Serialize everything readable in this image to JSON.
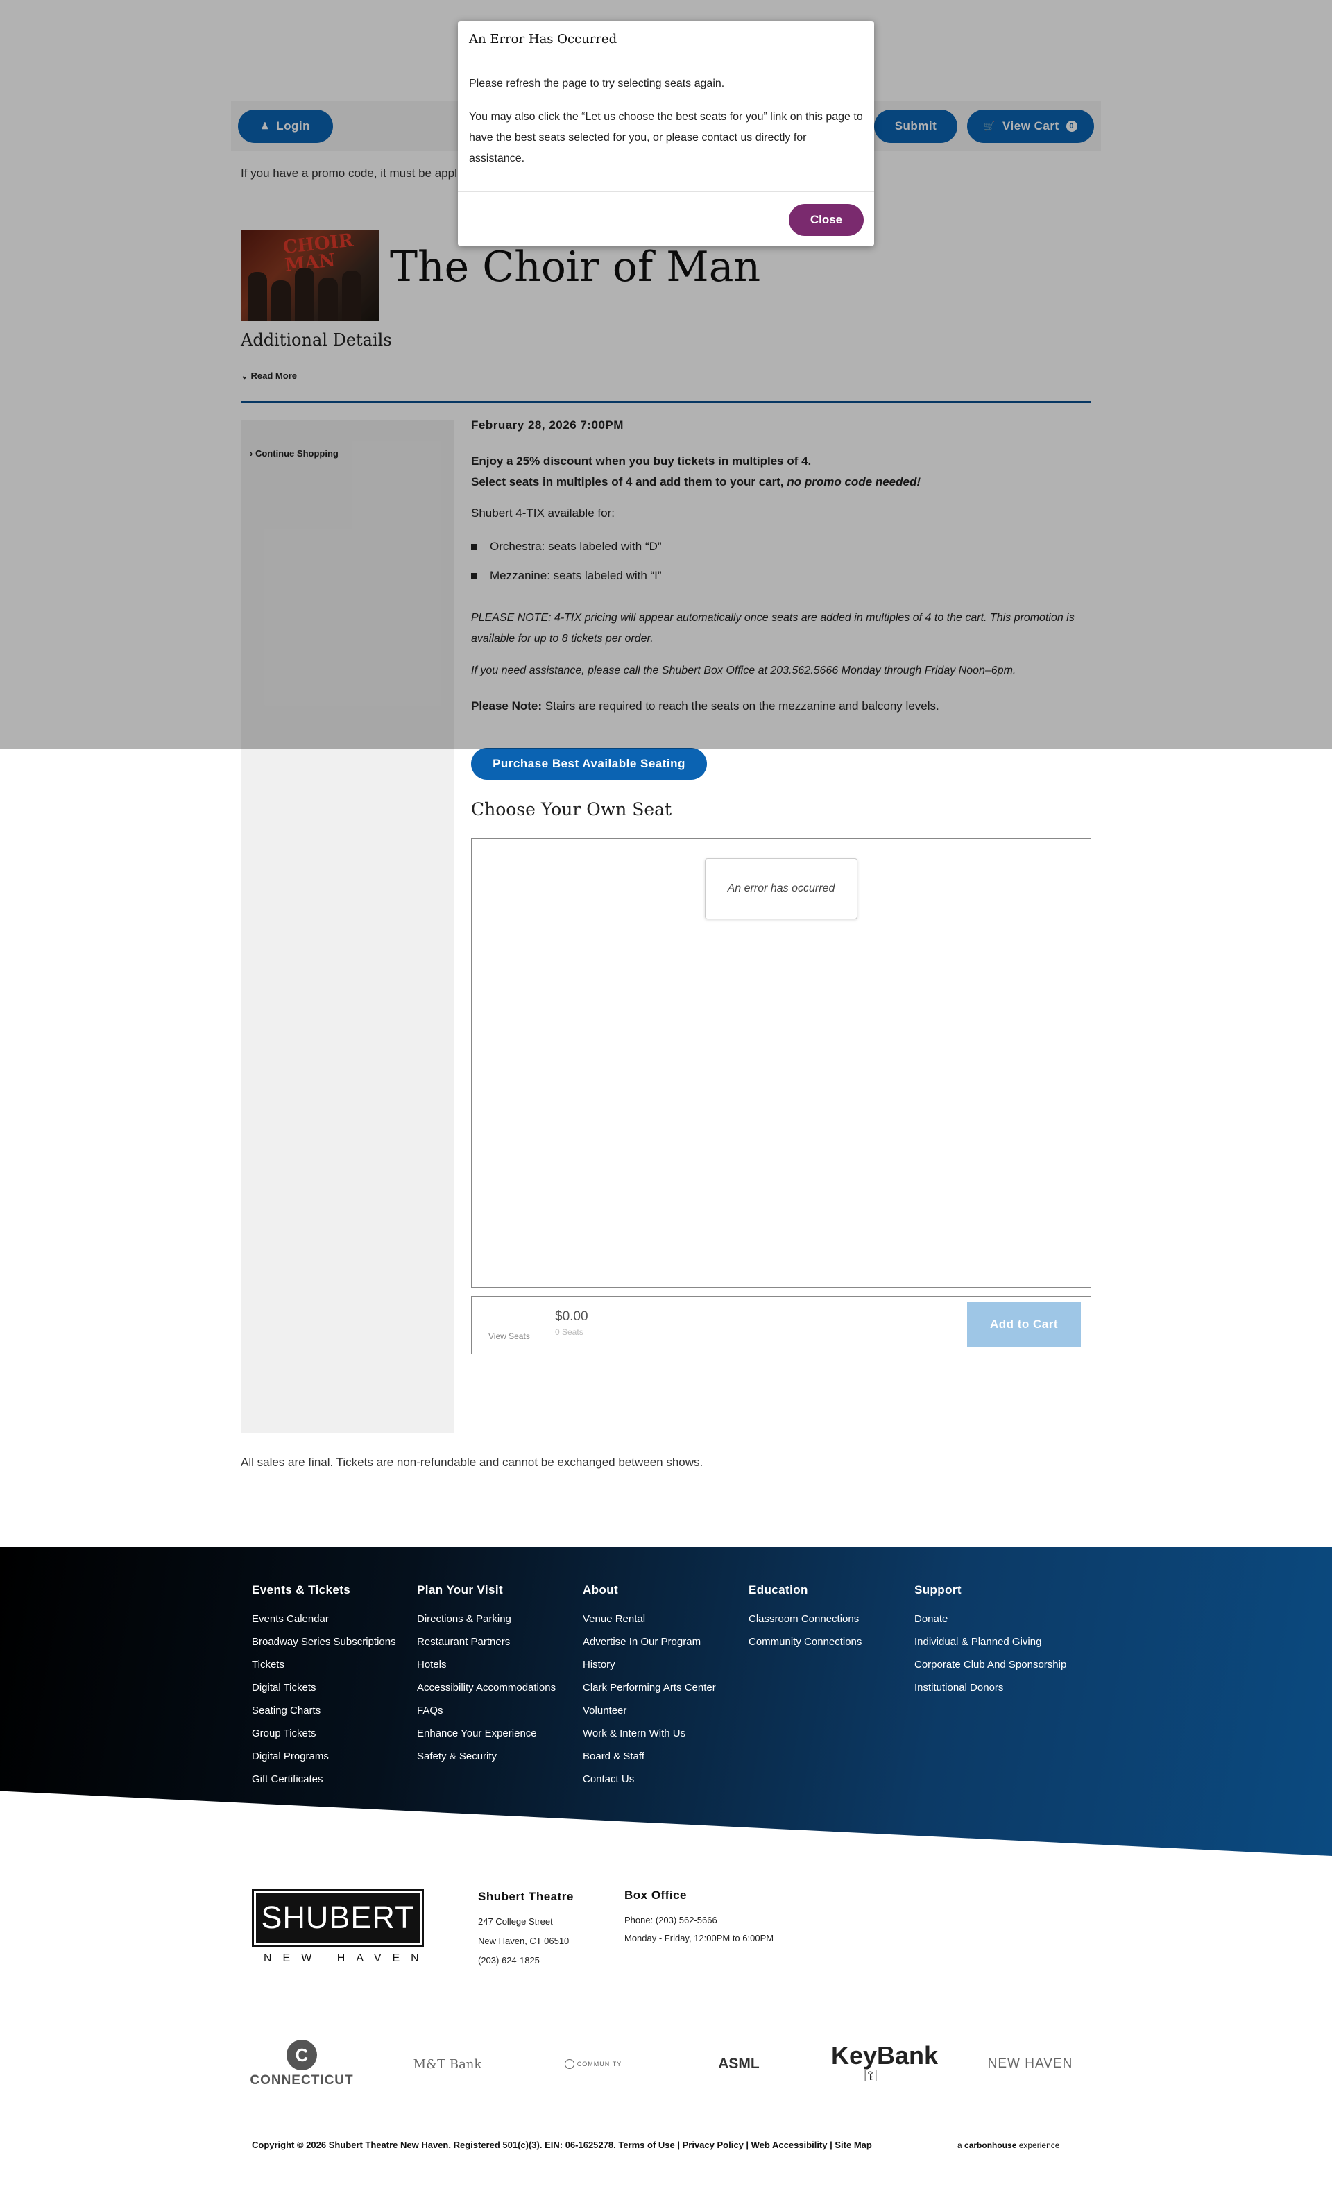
{
  "header": {
    "login_label": "Login",
    "submit_label": "Submit",
    "view_cart_label": "View Cart",
    "cart_count": "0",
    "promo_text": "If you have a promo code, it must be applied"
  },
  "event": {
    "title": "The Choir of Man",
    "image_text": "CHOIR MAN",
    "additional_details": "Additional Details",
    "read_more": "Read More",
    "continue_shopping": "Continue Shopping",
    "date": "February 28, 2026 7:00PM",
    "discount_line": "Enjoy a 25% discount when you buy tickets in multiples of 4.",
    "multiples_line": "Select seats in multiples of 4 and add them to your cart,",
    "multiples_em": "no promo code needed!",
    "tix_intro": "Shubert 4-TIX available for:",
    "bullet_orchestra": "Orchestra: seats labeled with “D”",
    "bullet_mezzanine": "Mezzanine: seats labeled with “I”",
    "please_note_italic": "PLEASE NOTE: 4-TIX pricing will appear automatically once seats are added in multiples of 4 to the cart. This promotion is available for up to 8 tickets per order.",
    "assistance": "If you need assistance, please call the Shubert Box Office at 203.562.5666 Monday through Friday Noon–6pm.",
    "please_note_label": "Please Note:",
    "please_note_text": " Stairs are required to reach the seats on the mezzanine and balcony levels.",
    "best_available_label": "Purchase Best Available Seating",
    "choose_own_seat": "Choose Your Own Seat",
    "map_error": "An error has occurred",
    "view_seats": "View Seats",
    "price": "$0.00",
    "seat_count": "0 Seats",
    "add_to_cart": "Add to Cart",
    "sales_final": "All sales are final. Tickets are non-refundable and cannot be exchanged between shows."
  },
  "modal": {
    "title": "An Error Has Occurred",
    "body1": "Please refresh the page to try selecting seats again.",
    "body2": "You may also click the “Let us choose the best seats for you” link on this page to have the best seats selected for you, or please contact us directly for assistance.",
    "close_label": "Close"
  },
  "footer": {
    "columns": [
      {
        "heading": "Events & Tickets",
        "links": [
          "Events Calendar",
          "Broadway Series Subscriptions",
          "Tickets",
          "Digital Tickets",
          "Seating Charts",
          "Group Tickets",
          "Digital Programs",
          "Gift Certificates"
        ]
      },
      {
        "heading": "Plan Your Visit",
        "links": [
          "Directions & Parking",
          "Restaurant Partners",
          "Hotels",
          "Accessibility Accommodations",
          "FAQs",
          "Enhance Your Experience",
          "Safety & Security"
        ]
      },
      {
        "heading": "About",
        "links": [
          "Venue Rental",
          "Advertise In Our Program",
          "History",
          "Clark Performing Arts Center",
          "Volunteer",
          "Work & Intern With Us",
          "Board & Staff",
          "Contact Us"
        ]
      },
      {
        "heading": "Education",
        "links": [
          "Classroom Connections",
          "Community Connections"
        ]
      },
      {
        "heading": "Support",
        "links": [
          "Donate",
          "Individual & Planned Giving",
          "Corporate Club And Sponsorship",
          "Institutional Donors"
        ]
      }
    ],
    "logo_main": "SHUBERT",
    "logo_sub": "NEW HAVEN",
    "theatre_heading": "Shubert Theatre",
    "theatre_address1": "247 College Street",
    "theatre_address2": "New Haven, CT 06510",
    "theatre_phone": "(203) 624-1825",
    "box_heading": "Box Office",
    "box_phone": "Phone: (203) 562-5666",
    "box_hours": "Monday - Friday, 12:00PM to 6:00PM",
    "sponsors": {
      "connecticut": "CONNECTICUT",
      "mt": "M&T Bank",
      "community": "COMMUNITY",
      "asml": "ASML",
      "keybank": "KeyBank",
      "newhaven": "NEW HAVEN"
    },
    "copyright": "Copyright © 2026 Shubert Theatre New Haven. Registered 501(c)(3). EIN: 06-1625278.",
    "terms": "Terms of Use",
    "privacy": "Privacy Policy",
    "accessibility": "Web Accessibility",
    "sitemap": "Site Map",
    "carbonhouse_pre": "a ",
    "carbonhouse_brand": "carbonhouse",
    "carbonhouse_post": " experience"
  }
}
